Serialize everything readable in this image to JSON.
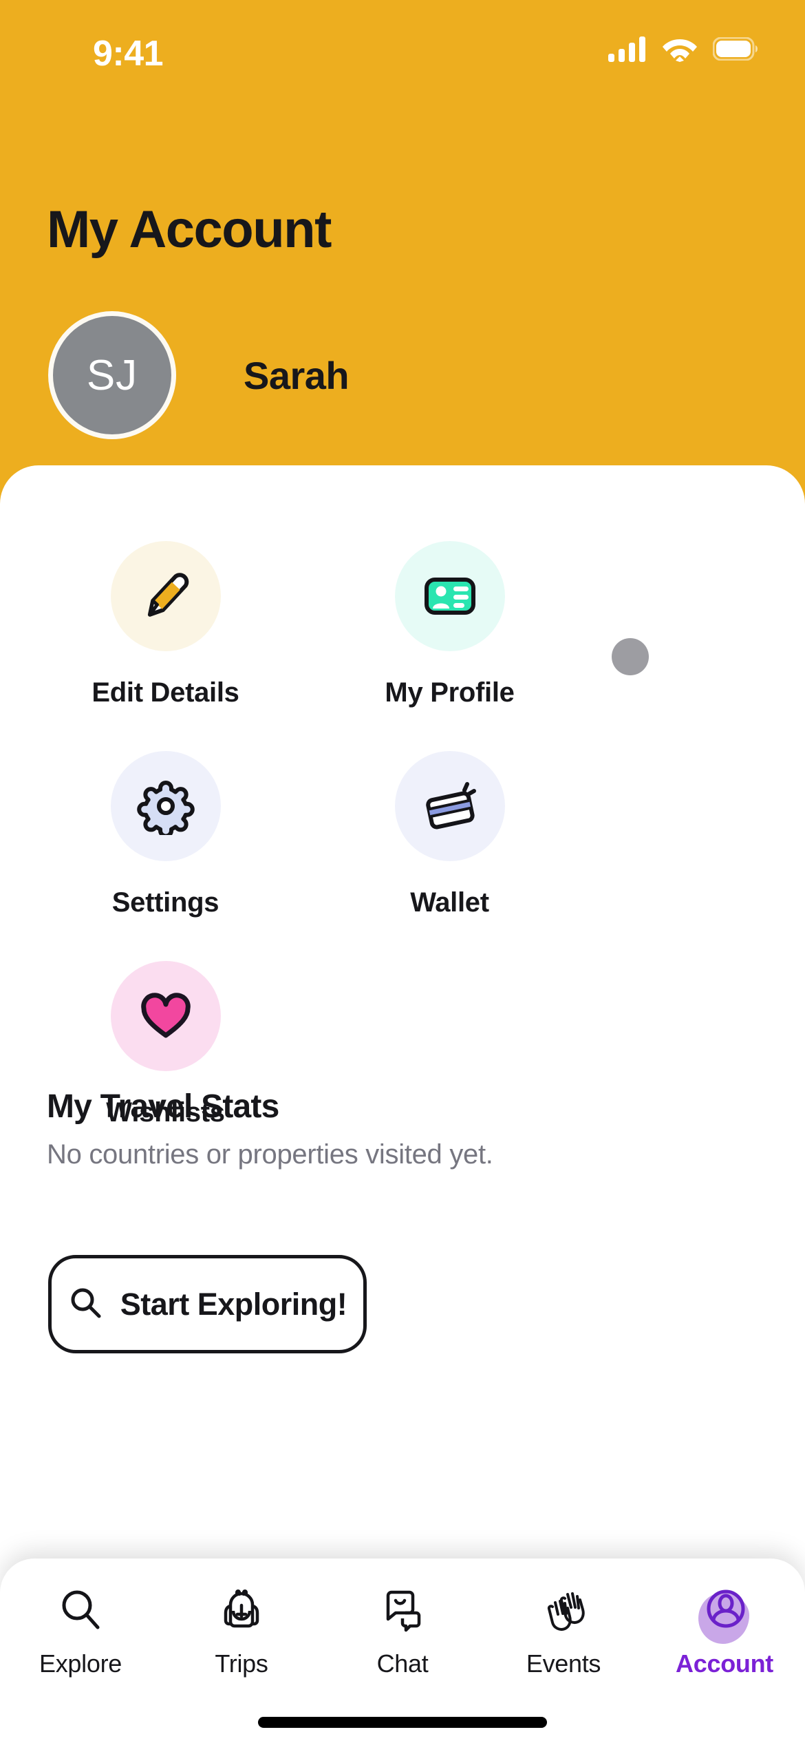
{
  "status_bar": {
    "time": "9:41",
    "cellular_icon": "signal-bars-icon",
    "wifi_icon": "wifi-icon",
    "battery_icon": "battery-icon"
  },
  "header": {
    "title": "My Account",
    "avatar_initials": "SJ",
    "user_name": "Sarah",
    "background_color": "#EDAE1F"
  },
  "actions": [
    {
      "label": "Edit Details",
      "icon": "pencil-icon",
      "circle_color": "#FBF5E4",
      "accent": "#EDAE1F"
    },
    {
      "label": "My Profile",
      "icon": "id-card-icon",
      "circle_color": "#E6FBF6",
      "accent": "#2AE5B0"
    },
    {
      "label": "Settings",
      "icon": "gear-icon",
      "circle_color": "#EFF1FB",
      "accent": "#D6DEF5"
    },
    {
      "label": "Wallet",
      "icon": "credit-card-icon",
      "circle_color": "#EFF1FB",
      "accent": "#8B9BE0"
    },
    {
      "label": "Wishlists",
      "icon": "heart-icon",
      "circle_color": "#FBDDF0",
      "accent": "#F2479F"
    }
  ],
  "stats": {
    "title": "My Travel Stats",
    "empty_message": "No countries or properties visited yet."
  },
  "cta": {
    "label": "Start Exploring!",
    "icon": "search-icon"
  },
  "bottom_nav": {
    "active_color": "#7B21D6",
    "items": [
      {
        "label": "Explore",
        "icon": "magnifier-icon",
        "active": false
      },
      {
        "label": "Trips",
        "icon": "backpack-icon",
        "active": false
      },
      {
        "label": "Chat",
        "icon": "chat-bubbles-icon",
        "active": false
      },
      {
        "label": "Events",
        "icon": "waving-hands-icon",
        "active": false
      },
      {
        "label": "Account",
        "icon": "person-circle-icon",
        "active": true
      }
    ]
  },
  "cursor": {
    "color": "#9d9da2"
  }
}
